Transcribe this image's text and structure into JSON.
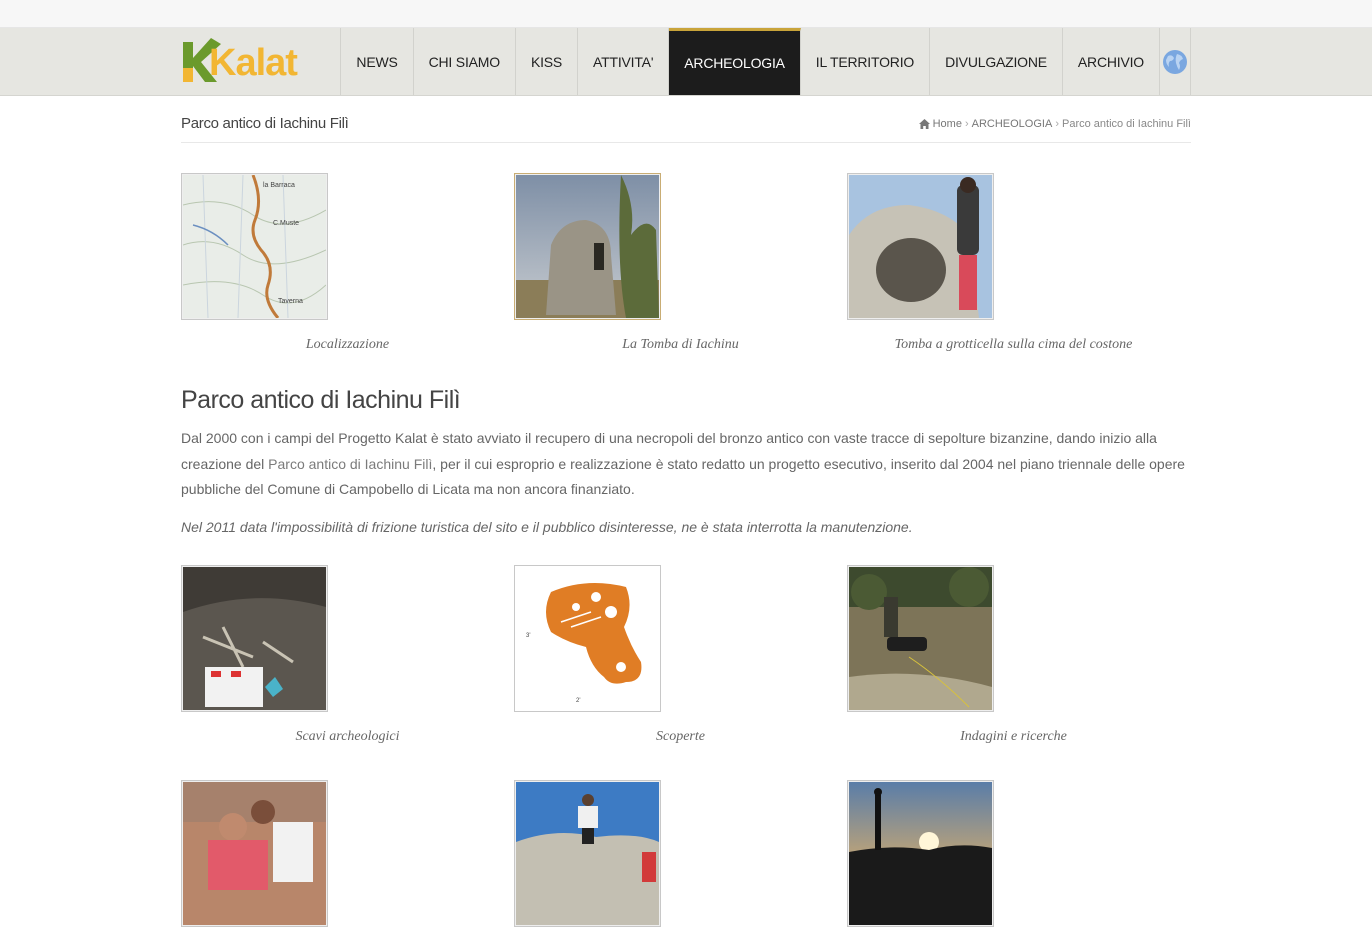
{
  "brand": {
    "name": "Kalat",
    "accent": "#f2b633",
    "mark_color": "#6b9a2c"
  },
  "nav": {
    "items": [
      "NEWS",
      "CHI SIAMO",
      "KISS",
      "ATTIVITA'",
      "ARCHEOLOGIA",
      "IL TERRITORIO",
      "DIVULGAZIONE",
      "ARCHIVIO"
    ],
    "active": "ARCHEOLOGIA",
    "language_icon": "globe-icon"
  },
  "page": {
    "title": "Parco antico di Iachinu Filì",
    "breadcrumb": {
      "home": "Home",
      "section": "ARCHEOLOGIA",
      "current": "Parco antico di Iachinu Filì"
    }
  },
  "gallery_top": [
    {
      "caption": "Localizzazione"
    },
    {
      "caption": "La Tomba di Iachinu"
    },
    {
      "caption": "Tomba a grotticella sulla cima del costone"
    }
  ],
  "article": {
    "heading": "Parco antico di Iachinu Filì",
    "p1_a": "Dal 2000 con i campi del Progetto Kalat è stato avviato il recupero di una necropoli del bronzo antico con vaste tracce di sepolture bizanzine,  dando inizio alla creazione del ",
    "p1_link": "Parco antico di Iachinu Filì",
    "p1_b": ", per il cui esproprio e realizzazione  è stato redatto un progetto esecutivo, inserito dal 2004 nel piano triennale delle opere pubbliche del Comune di Campobello di Licata ma non ancora finanziato.",
    "note": "Nel 2011 data l'impossibilità di frizione turistica del sito e il pubblico disinteresse, ne è stata interrotta la manutenzione."
  },
  "gallery_mid": [
    {
      "caption": "Scavi archeologici"
    },
    {
      "caption": "Scoperte"
    },
    {
      "caption": "Indagini e ricerche"
    }
  ]
}
